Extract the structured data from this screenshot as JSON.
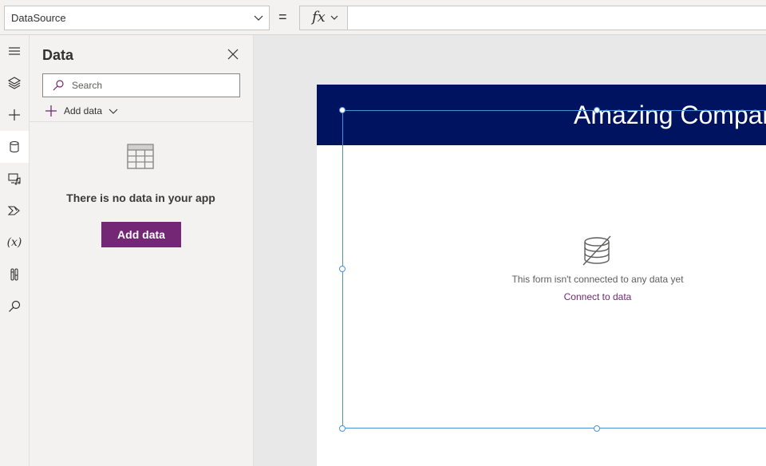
{
  "formula_bar": {
    "property": "DataSource",
    "equals": "=",
    "fx": "fx",
    "formula": ""
  },
  "rail": {
    "items": [
      {
        "name": "menu-icon"
      },
      {
        "name": "tree-view-icon"
      },
      {
        "name": "insert-icon"
      },
      {
        "name": "data-icon",
        "active": true
      },
      {
        "name": "media-icon"
      },
      {
        "name": "power-automate-icon"
      },
      {
        "name": "variables-icon",
        "text": "(x)"
      },
      {
        "name": "advanced-tools-icon"
      },
      {
        "name": "search-icon"
      }
    ]
  },
  "panel": {
    "title": "Data",
    "search_placeholder": "Search",
    "add_data_link": "Add data",
    "empty_message": "There is no data in your app",
    "add_data_button": "Add data"
  },
  "canvas": {
    "header_title": "Amazing Company",
    "form_message": "This form isn't connected to any data yet",
    "connect_link": "Connect to data"
  },
  "colors": {
    "accent": "#742774",
    "header_bg": "#001360",
    "selection": "#4a90d9"
  }
}
